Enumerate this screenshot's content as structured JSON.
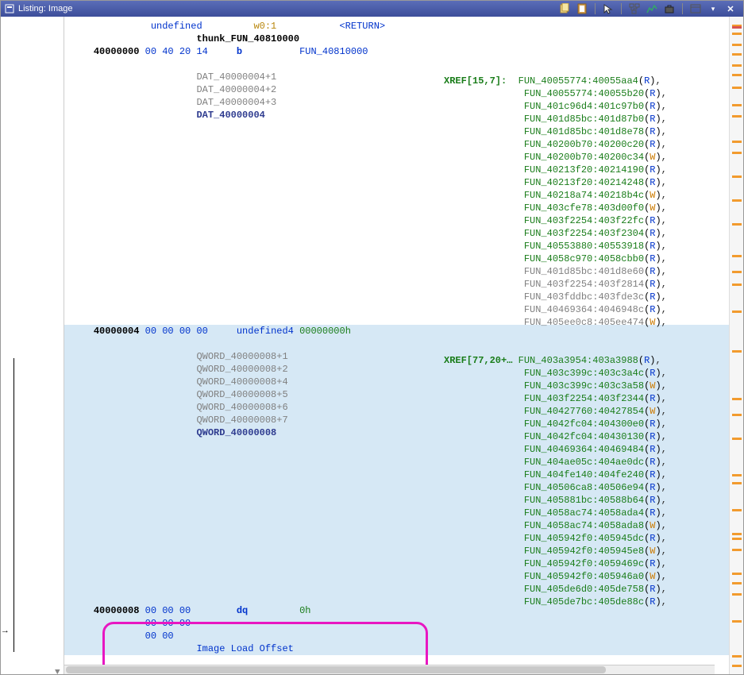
{
  "window": {
    "title": "Listing:  Image"
  },
  "toolbar": {
    "copy": "copy-icon",
    "paste": "paste-icon",
    "cursor": "cursor-icon",
    "toggle1": "tree-icon",
    "toggle2": "graph-icon",
    "briefcase": "briefcase-icon",
    "panel": "panel-icon",
    "dropdown": "▾",
    "close": "✕"
  },
  "header_row": {
    "type": "undefined",
    "reg": "w0:1",
    "ret": "<RETURN>"
  },
  "thunk_line": "thunk_FUN_40810000",
  "line_b": {
    "addr": "40000000",
    "bytes": "00 40 20 14",
    "mnem": "b",
    "target": "FUN_40810000"
  },
  "dat_labels": [
    "DAT_40000004+1",
    "DAT_40000004+2",
    "DAT_40000004+3",
    "DAT_40000004"
  ],
  "xref1_tag": "XREF[15,7]:",
  "xref1": [
    {
      "f": "FUN_40055774:40055aa4",
      "rw": "R",
      "cls": "g"
    },
    {
      "f": "FUN_40055774:40055b20",
      "rw": "R",
      "cls": "g"
    },
    {
      "f": "FUN_401c96d4:401c97b0",
      "rw": "R",
      "cls": "g"
    },
    {
      "f": "FUN_401d85bc:401d87b0",
      "rw": "R",
      "cls": "g"
    },
    {
      "f": "FUN_401d85bc:401d8e78",
      "rw": "R",
      "cls": "g"
    },
    {
      "f": "FUN_40200b70:40200c20",
      "rw": "R",
      "cls": "g"
    },
    {
      "f": "FUN_40200b70:40200c34",
      "rw": "W",
      "cls": "g"
    },
    {
      "f": "FUN_40213f20:40214190",
      "rw": "R",
      "cls": "g"
    },
    {
      "f": "FUN_40213f20:40214248",
      "rw": "R",
      "cls": "g"
    },
    {
      "f": "FUN_40218a74:40218b4c",
      "rw": "W",
      "cls": "g"
    },
    {
      "f": "FUN_403cfe78:403d00f0",
      "rw": "W",
      "cls": "g"
    },
    {
      "f": "FUN_403f2254:403f22fc",
      "rw": "R",
      "cls": "g"
    },
    {
      "f": "FUN_403f2254:403f2304",
      "rw": "R",
      "cls": "g"
    },
    {
      "f": "FUN_40553880:40553918",
      "rw": "R",
      "cls": "g"
    },
    {
      "f": "FUN_4058c970:4058cbb0",
      "rw": "R",
      "cls": "g"
    },
    {
      "f": "FUN_401d85bc:401d8e60",
      "rw": "R",
      "cls": "gr"
    },
    {
      "f": "FUN_403f2254:403f2814",
      "rw": "R",
      "cls": "gr"
    },
    {
      "f": "FUN_403fddbc:403fde3c",
      "rw": "R",
      "cls": "gr"
    },
    {
      "f": "FUN_40469364:4046948c",
      "rw": "R",
      "cls": "gr"
    },
    {
      "f": "FUN_405ee0c8:405ee474",
      "rw": "W",
      "cls": "gr"
    }
  ],
  "line_u4": {
    "addr": "40000004",
    "bytes": "00 00 00 00",
    "type": "undefined4",
    "value": "00000000h"
  },
  "qword_labels": [
    "QWORD_40000008+1",
    "QWORD_40000008+2",
    "QWORD_40000008+4",
    "QWORD_40000008+5",
    "QWORD_40000008+6",
    "QWORD_40000008+7",
    "QWORD_40000008"
  ],
  "xref2_tag": "XREF[77,20+…",
  "xref2": [
    {
      "f": "FUN_403a3954:403a3988",
      "rw": "R",
      "cls": "g"
    },
    {
      "f": "FUN_403c399c:403c3a4c",
      "rw": "R",
      "cls": "g"
    },
    {
      "f": "FUN_403c399c:403c3a58",
      "rw": "W",
      "cls": "g"
    },
    {
      "f": "FUN_403f2254:403f2344",
      "rw": "R",
      "cls": "g"
    },
    {
      "f": "FUN_40427760:40427854",
      "rw": "W",
      "cls": "g"
    },
    {
      "f": "FUN_4042fc04:404300e0",
      "rw": "R",
      "cls": "g"
    },
    {
      "f": "FUN_4042fc04:40430130",
      "rw": "R",
      "cls": "g"
    },
    {
      "f": "FUN_40469364:40469484",
      "rw": "R",
      "cls": "g"
    },
    {
      "f": "FUN_404ae05c:404ae0dc",
      "rw": "R",
      "cls": "g"
    },
    {
      "f": "FUN_404fe140:404fe240",
      "rw": "R",
      "cls": "g"
    },
    {
      "f": "FUN_40506ca8:40506e94",
      "rw": "R",
      "cls": "g"
    },
    {
      "f": "FUN_405881bc:40588b64",
      "rw": "R",
      "cls": "g"
    },
    {
      "f": "FUN_4058ac74:4058ada4",
      "rw": "R",
      "cls": "g"
    },
    {
      "f": "FUN_4058ac74:4058ada8",
      "rw": "W",
      "cls": "g"
    },
    {
      "f": "FUN_405942f0:405945dc",
      "rw": "R",
      "cls": "g"
    },
    {
      "f": "FUN_405942f0:405945e8",
      "rw": "W",
      "cls": "g"
    },
    {
      "f": "FUN_405942f0:4059469c",
      "rw": "R",
      "cls": "g"
    },
    {
      "f": "FUN_405942f0:405946a0",
      "rw": "W",
      "cls": "g"
    },
    {
      "f": "FUN_405de6d0:405de758",
      "rw": "R",
      "cls": "g"
    },
    {
      "f": "FUN_405de7bc:405de88c",
      "rw": "R",
      "cls": "g"
    }
  ],
  "line_dq": {
    "addr": "40000008",
    "bytes1": "00 00 00",
    "mnem": "dq",
    "value": "0h",
    "bytes2": "00 00 00",
    "bytes3": "00 00",
    "comment": "Image Load Offset"
  },
  "ov_marks": [
    10,
    20,
    34,
    46,
    60,
    72,
    88,
    110,
    124,
    156,
    170,
    200,
    230,
    260,
    300,
    320,
    336,
    370,
    420,
    480,
    500,
    530,
    576,
    586,
    620,
    650,
    656,
    670,
    700,
    712,
    726,
    760,
    804,
    816
  ],
  "ov_red": [
    12
  ]
}
